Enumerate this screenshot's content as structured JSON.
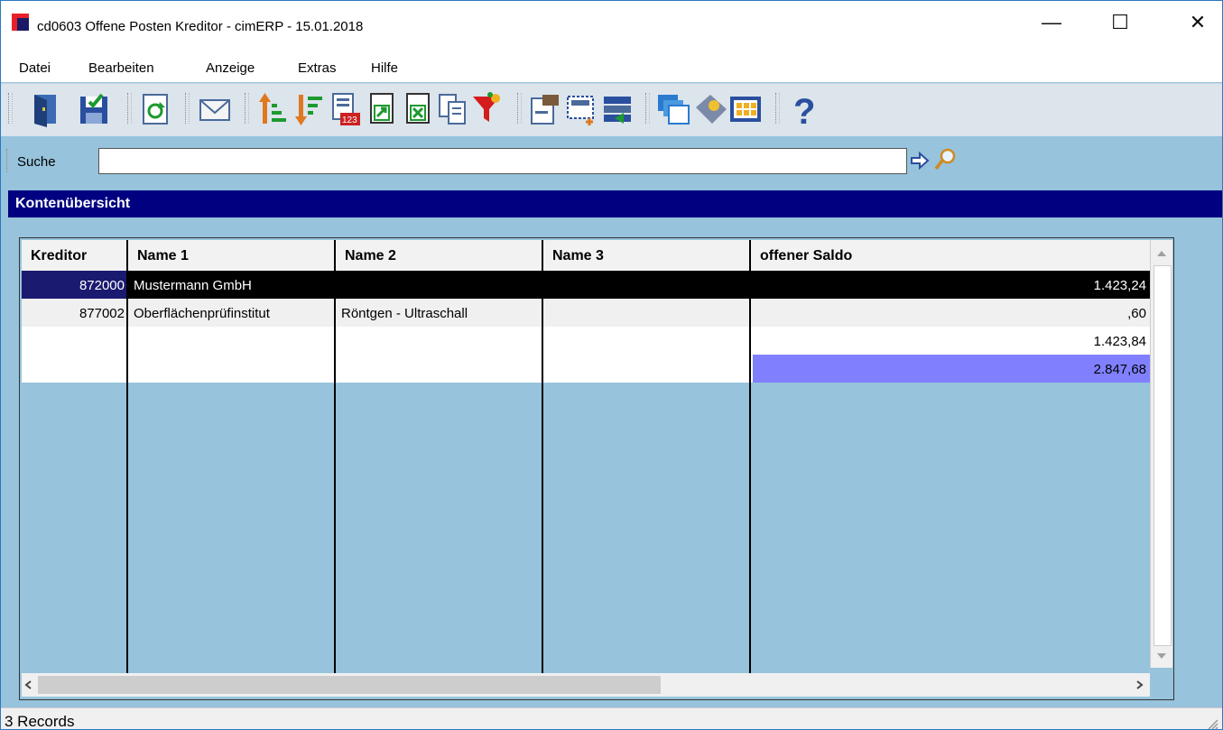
{
  "window": {
    "title": "cd0603 Offene Posten Kreditor - cimERP - 15.01.2018"
  },
  "menu": [
    {
      "label": "Datei"
    },
    {
      "label": "Bearbeiten"
    },
    {
      "label": "Anzeige"
    },
    {
      "label": "Extras"
    },
    {
      "label": "Hilfe"
    }
  ],
  "toolbar": {
    "icons": [
      "exit-icon",
      "save-icon",
      "refresh-icon",
      "mail-icon",
      "sort-ascending-icon",
      "sort-descending-icon",
      "number-format-icon",
      "export-document-icon",
      "export-excel-icon",
      "copy-icon",
      "filter-icon",
      "properties-icon",
      "new-selection-icon",
      "layout-icon",
      "windows-icon",
      "tag-icon",
      "calculator-icon",
      "help-icon"
    ]
  },
  "search": {
    "label": "Suche",
    "value": ""
  },
  "section": {
    "title": "Kontenübersicht"
  },
  "table": {
    "columns": [
      "Kreditor",
      "Name 1",
      "Name 2",
      "Name 3",
      "offener Saldo"
    ],
    "rows": [
      {
        "kreditor": "872000",
        "name1": "Mustermann GmbH",
        "name2": "",
        "name3": "",
        "saldo": "1.423,24"
      },
      {
        "kreditor": "877002",
        "name1": "Oberflächenprüfinstitut",
        "name2": "Röntgen - Ultraschall",
        "name3": "",
        "saldo": ",60"
      }
    ],
    "totals": [
      {
        "saldo": "1.423,84"
      },
      {
        "saldo": "2.847,68"
      }
    ]
  },
  "status": {
    "text": "3 Records"
  },
  "colors": {
    "selected_row": "#000000",
    "total_highlight": "#8080ff",
    "header_band": "#000080",
    "background": "#97c3dc"
  }
}
